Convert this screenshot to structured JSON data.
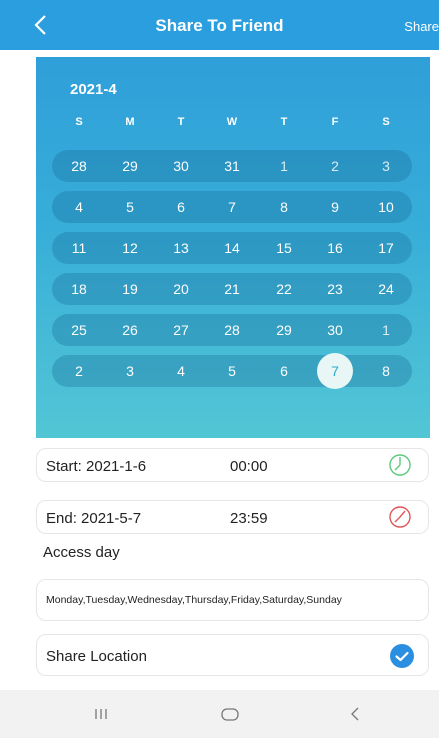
{
  "header": {
    "title": "Share To Friend",
    "action_label": "Share"
  },
  "calendar": {
    "month_label": "2021-4",
    "weekdays": [
      "S",
      "M",
      "T",
      "W",
      "T",
      "F",
      "S"
    ],
    "weeks": [
      [
        "28",
        "29",
        "30",
        "31",
        "1",
        "2",
        "3"
      ],
      [
        "4",
        "5",
        "6",
        "7",
        "8",
        "9",
        "10"
      ],
      [
        "11",
        "12",
        "13",
        "14",
        "15",
        "16",
        "17"
      ],
      [
        "18",
        "19",
        "20",
        "21",
        "22",
        "23",
        "24"
      ],
      [
        "25",
        "26",
        "27",
        "28",
        "29",
        "30",
        "1"
      ],
      [
        "2",
        "3",
        "4",
        "5",
        "6",
        "7",
        "8"
      ]
    ],
    "selected_day": "7"
  },
  "start": {
    "label": "Start: 2021-1-6",
    "time": "00:00"
  },
  "end": {
    "label": "End: 2021-5-7",
    "time": "23:59"
  },
  "access": {
    "title": "Access day",
    "days": "Monday,Tuesday,Wednesday,Thursday,Friday,Saturday,Sunday"
  },
  "share_location": {
    "label": "Share Location",
    "checked": true
  },
  "colors": {
    "header": "#2a9ede",
    "start_clock": "#5cc97a",
    "end_clock": "#e0575b",
    "check": "#2a8fe0"
  },
  "icons": [
    "back-arrow-icon",
    "clock-icon",
    "check-circle-icon",
    "recents-icon",
    "home-icon",
    "back-icon"
  ]
}
